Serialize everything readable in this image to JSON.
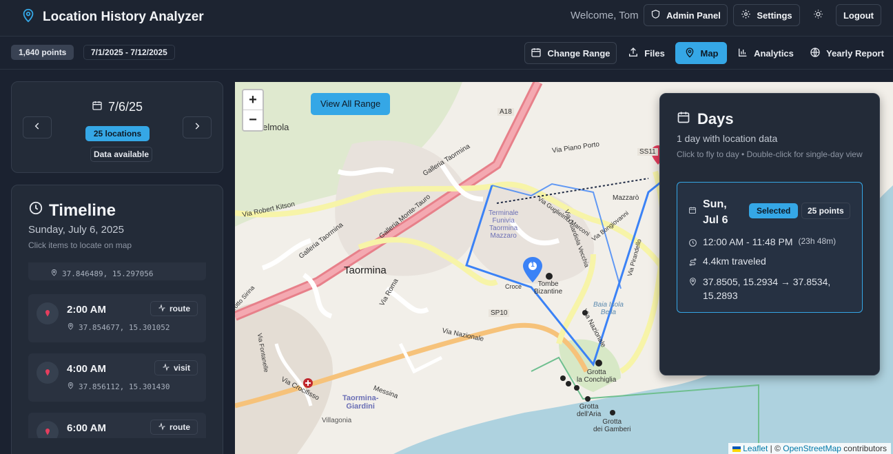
{
  "header": {
    "title": "Location History Analyzer",
    "welcome": "Welcome, Tom",
    "admin_label": "Admin Panel",
    "settings_label": "Settings",
    "logout_label": "Logout"
  },
  "toolbar": {
    "points": "1,640 points",
    "range": "7/1/2025 - 7/12/2025",
    "change_range": "Change Range",
    "files": "Files",
    "map": "Map",
    "analytics": "Analytics",
    "yearly_report": "Yearly Report",
    "active_tab": "Map"
  },
  "date_panel": {
    "date": "7/6/25",
    "locations": "25 locations",
    "availability": "Data available"
  },
  "timeline": {
    "title": "Timeline",
    "subtitle": "Sunday, July 6, 2025",
    "hint": "Click items to locate on map",
    "items": [
      {
        "time": "",
        "tag": "",
        "coord": "37.846489, 15.297056"
      },
      {
        "time": "2:00 AM",
        "tag": "route",
        "coord": "37.854677, 15.301052"
      },
      {
        "time": "4:00 AM",
        "tag": "visit",
        "coord": "37.856112, 15.301430"
      },
      {
        "time": "6:00 AM",
        "tag": "route",
        "coord": ""
      }
    ]
  },
  "map": {
    "view_all": "View All Range",
    "zoom_in": "+",
    "zoom_out": "−",
    "attribution_leaflet": "Leaflet",
    "attribution_sep": " | © ",
    "attribution_osm": "OpenStreetMap",
    "attribution_tail": " contributors",
    "marker_number": "1",
    "labels": {
      "castelmola": "stelmola",
      "a18": "A18",
      "galleria_taormina": "Galleria Taormina",
      "via_robert_kitson": "Via Robert Kitson",
      "galleria_monte_tauro": "Galleria Monte-Tauro",
      "galleria_taormina2": "Galleria Taormina",
      "taormina": "Taormina",
      "terminale": "Terminale\nFunivia\nTaormina\nMazzaro",
      "tombe": "Tombe\nBizantine",
      "sp10": "SP10",
      "via_nazionale": "Via Nazionale",
      "via_nazionale2": "Via Nazionale",
      "baia": "Baia Isola\nBella",
      "grotta_conchiglia": "Grotta\nla Conchiglia",
      "grotta_aria": "Grotta\ndell'Aria",
      "grotta_gamberi": "Grotta\ndei Gamberi",
      "taormina_giardini": "Taormina-\nGiardini",
      "villagonia": "Villagonia",
      "messina": "Messina",
      "via_crocifisso": "Via Crocifisso",
      "via_roma": "Via Roma",
      "via_piano_porto": "Via Piano Porto",
      "mazzaro": "Mazzarò",
      "ss114": "SS11",
      "via_guglielmo": "Via Guglielmo Marconi",
      "via_bongiovanni": "Via Bongiovanni",
      "via_fontanelle": "Via Fontanelle",
      "sirina": "Trotto Sirina",
      "croce": "Croce",
      "via_guardiola": "Via Guardiola Vecchia",
      "via_pirandello": "Via Pirandello"
    }
  },
  "days": {
    "title": "Days",
    "count": "1 day with location data",
    "hint": "Click to fly to day • Double-click for single-day view",
    "card": {
      "date": "Sun, Jul 6",
      "selected": "Selected",
      "points": "25 points",
      "time_range": "12:00 AM - 11:48 PM",
      "duration": "(23h 48m)",
      "distance": "4.4km traveled",
      "coords": "37.8505, 15.2934 → 37.8534, 15.2893"
    }
  },
  "colors": {
    "accent": "#35a7e6",
    "background": "#1b2230",
    "panel": "#232b38",
    "route": "#3b82f6",
    "pin": "#e53e5e"
  }
}
